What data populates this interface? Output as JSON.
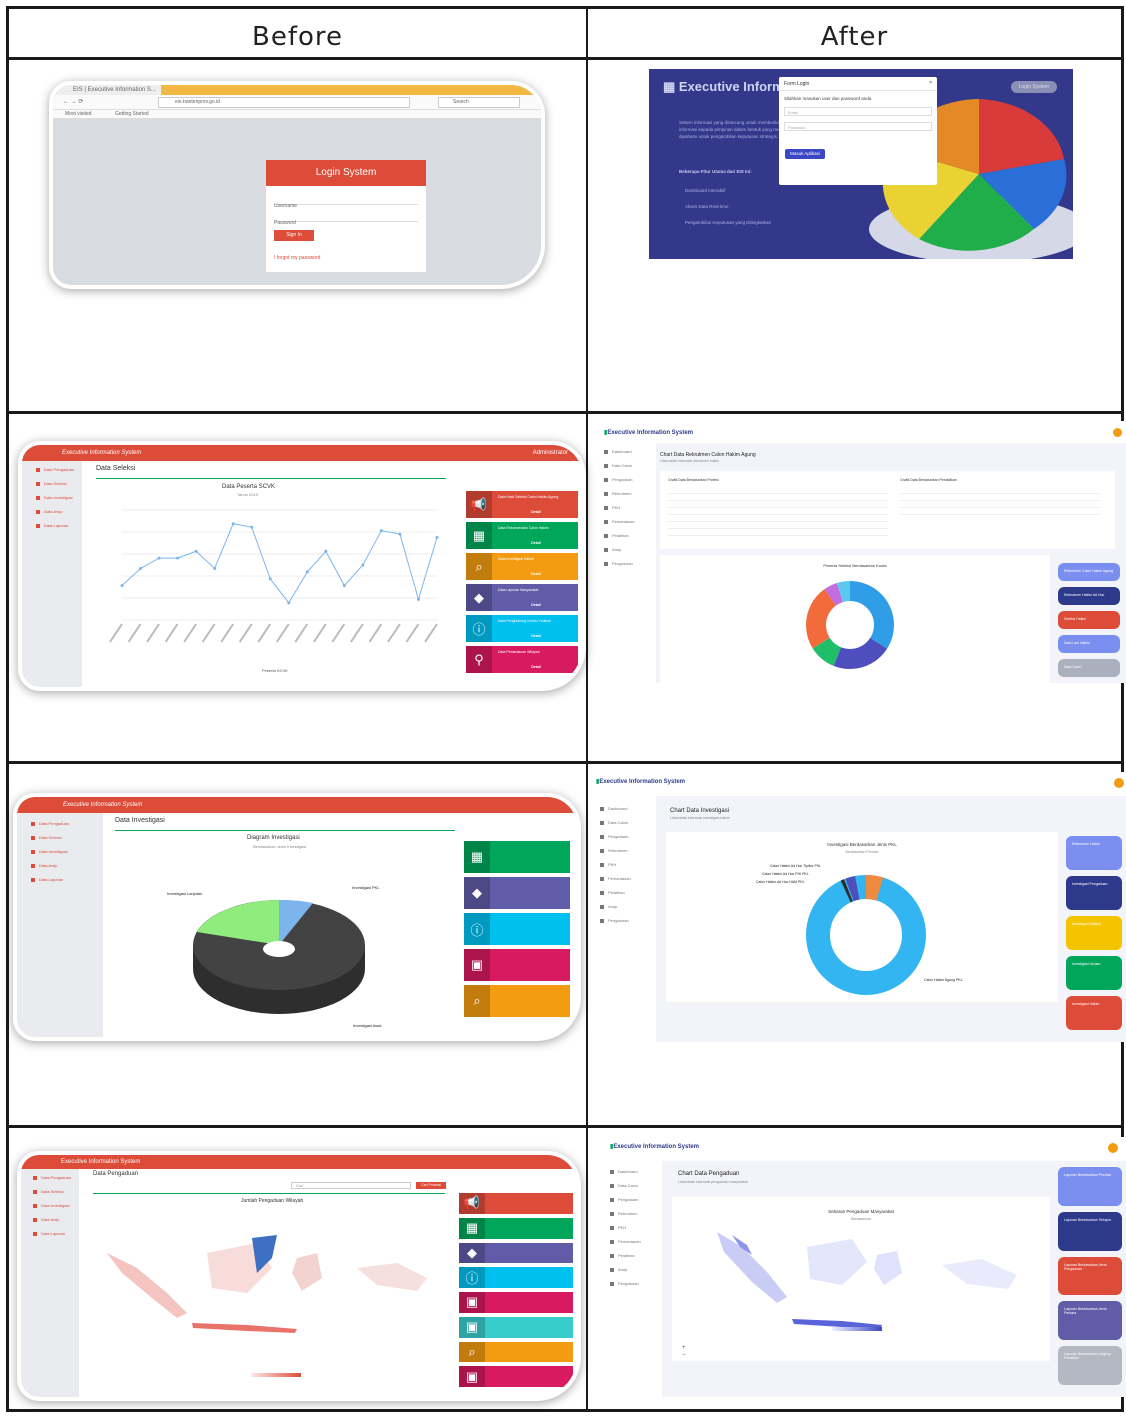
{
  "headers": {
    "before": "Before",
    "after": "After"
  },
  "row1": {
    "before": {
      "browser_tab": "EIS | Executive Information S...",
      "browser_url": "eis-bantenprov.go.id",
      "bookmarks": [
        "Most visited",
        "Getting Started"
      ],
      "search_placeholder": "Search",
      "login_title": "Login System",
      "username_placeholder": "Username",
      "password_placeholder": "Password",
      "signin_label": "Sign In",
      "forgot_label": "I forgot my password"
    },
    "after": {
      "brand": "Executive Information System",
      "login_button": "Login System",
      "modal_title": "Form Login",
      "modal_hint": "Silahkan masukan user dan password anda",
      "email_placeholder": "Email",
      "password_placeholder": "Password",
      "submit_label": "Masuk Aplikasi",
      "intro_text": "Sistem informasi yang dirancang untuk memberikan informasi kepada pimpinan dalam bentuk yang mudah dipahami untuk pengambilan keputusan strategis.",
      "benefits_title": "Beberapa Fitur Utama dari EIS Ini:",
      "benefits": [
        "Dashboard Interaktif",
        "Akses Data Real-time",
        "Pengambilan Keputusan yang Ditingkatkan"
      ]
    }
  },
  "row2": {
    "before": {
      "brand": "Executive Information System",
      "user": "Administrator",
      "page_title": "Data Seleksi",
      "chart_title": "Data Peserta SCVK",
      "chart_sub": "Tahun 2019",
      "legend": "Peserta SCVK",
      "menu": [
        "Data Pengaduan",
        "Data Seleksi",
        "Data Investigasi",
        "Data Arsip",
        "Data Laporan"
      ],
      "widgets": [
        {
          "icon": "megaphone",
          "text": "Data Hasil Seleksi Calon Hakim Agung",
          "more": "Detail"
        },
        {
          "icon": "calendar",
          "text": "Data Rekomendasi Calon Hakim",
          "more": "Detail"
        },
        {
          "icon": "search",
          "text": "Data Investigasi Hakim",
          "more": "Detail"
        },
        {
          "icon": "tags",
          "text": "Data Laporan Masyarakat",
          "more": "Detail"
        },
        {
          "icon": "info",
          "text": "Data Penghubung Komisi Yudisial",
          "more": "Detail"
        },
        {
          "icon": "map",
          "text": "Data Pemantauan Wilayah",
          "more": "Detail"
        }
      ]
    },
    "after": {
      "brand": "Executive Information System",
      "page_title": "Chart Data Rekrutmen Calon Hakim Agung",
      "page_sub": "Lihat detail informasi rekrutmen hakim",
      "table1_title": "Grafik Data Berdasarkan Profesi",
      "table2_title": "Grafik Data Berdasarkan Pendidikan",
      "chart_title": "Peserta Seleksi Berdasarkan Kuota",
      "menu": [
        "Dashboard",
        "Data Calon",
        "Pengaduan",
        "Rekrutmen",
        "PKH",
        "Pemantauan",
        "Pelatihan",
        "Arsip",
        "Pengaturan"
      ],
      "buttons": [
        "Rekrutmen Calon Hakim Agung",
        "Rekrutmen Hakim Ad Hoc",
        "Seleksi Hakim",
        "Data Lain Hakim",
        "Data Calon"
      ]
    }
  },
  "row3": {
    "before": {
      "brand": "Executive Information System",
      "page_title": "Data Investigasi",
      "chart_title": "Diagram Investigasi",
      "chart_sub": "Berdasarkan Jenis Investigasi",
      "labels": [
        "Investigasi Lanjutan",
        "Investigasi PKL",
        "Investigasi Awal"
      ],
      "menu": [
        "Data Pengaduan",
        "Data Seleksi",
        "Data Investigasi",
        "Data Arsip",
        "Data Laporan"
      ]
    },
    "after": {
      "brand": "Executive Information System",
      "page_title": "Chart Data Investigasi",
      "page_sub": "Lihat detail informasi investigasi hakim",
      "chart_title": "Investigasi Berdasarkan Jenis PKL",
      "chart_sub": "Berdasarkan Periode",
      "labels": [
        "Calon Hakim Ad Hoc Tipikor PKL",
        "Calon Hakim Ad Hoc PHI PKL",
        "Calon Hakim Ad Hoc HAM PKL",
        "Calon Hakim Agung PKL"
      ],
      "menu": [
        "Dashboard",
        "Data Calon",
        "Pengaduan",
        "Rekrutmen",
        "PKH",
        "Pemantauan",
        "Pelatihan",
        "Arsip",
        "Pengaturan"
      ],
      "buttons": [
        "Rekrutmen Hakim",
        "Investigasi Pengaduan",
        "Investigasi Seleksi",
        "Investigasi Usulan",
        "Investigasi Hakim"
      ]
    }
  },
  "row4": {
    "before": {
      "brand": "Executive Information System",
      "page_title": "Data Pengaduan",
      "map_title": "Jumlah Pengaduan Wilayah",
      "search_placeholder": "Cari",
      "search_button": "Cari Provinsi",
      "menu": [
        "Data Pengaduan",
        "Data Seleksi",
        "Data Investigasi",
        "Data Arsip",
        "Data Laporan"
      ]
    },
    "after": {
      "brand": "Executive Information System",
      "page_title": "Chart Data Pengaduan",
      "page_sub": "Lihat detail informasi pengaduan masyarakat",
      "map_title": "Sebaran Pengaduan Masyarakat",
      "map_sub": "Berdasarkan",
      "zoom_in": "+",
      "zoom_out": "−",
      "menu": [
        "Dashboard",
        "Data Calon",
        "Pengaduan",
        "Rekrutmen",
        "PKH",
        "Pemantauan",
        "Pelatihan",
        "Arsip",
        "Pengaturan"
      ],
      "buttons": [
        "Laporan Berdasarkan Provinsi",
        "Laporan Berdasarkan Terlapor",
        "Laporan Berdasarkan Jenis Pengaduan",
        "Laporan Berdasarkan Jenis Perkara",
        "Laporan Berdasarkan Lingkup Peradilan"
      ]
    }
  },
  "colors": {
    "red": "#dd4b39",
    "green": "#00a65a",
    "orange": "#f39c12",
    "purple": "#605ca8",
    "aqua": "#00c0ef",
    "pink": "#d81b60",
    "teal": "#39cccc",
    "navy": "#2d3a8c",
    "soft_blue": "#7b8ff0"
  }
}
